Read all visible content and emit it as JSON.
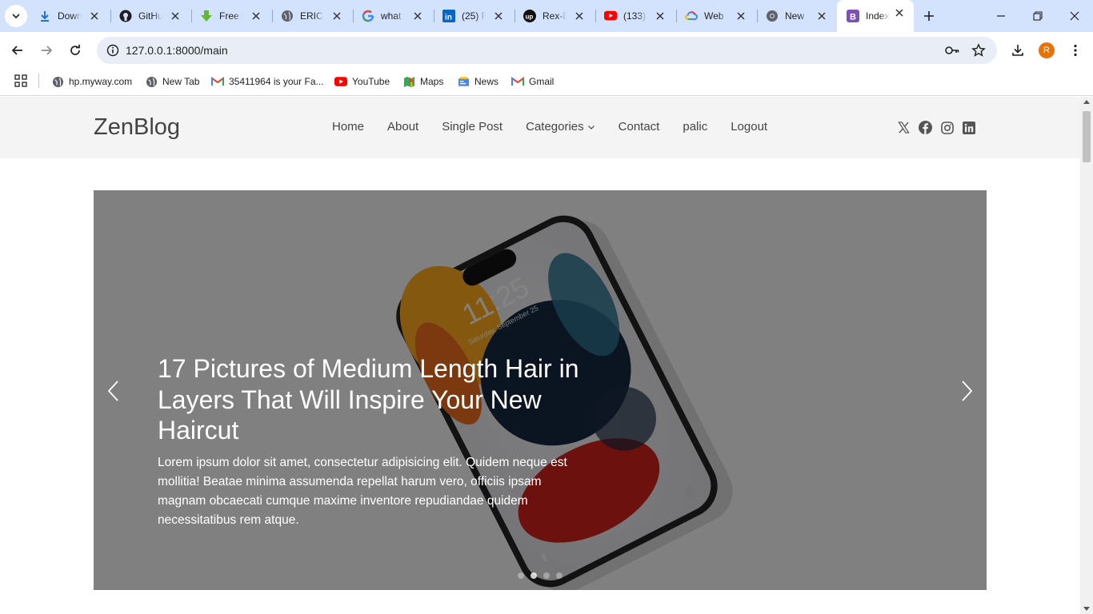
{
  "browser": {
    "tabs": [
      {
        "title": "Downloads",
        "icon": "download-icon"
      },
      {
        "title": "GitHub",
        "icon": "github-icon"
      },
      {
        "title": "Free Download",
        "icon": "download-arrow-icon"
      },
      {
        "title": "ERIC",
        "icon": "globe-icon"
      },
      {
        "title": "what",
        "icon": "google-icon"
      },
      {
        "title": "(25) F",
        "icon": "linkedin-icon"
      },
      {
        "title": "Rex-D",
        "icon": "upwork-icon"
      },
      {
        "title": "(133)",
        "icon": "youtube-icon"
      },
      {
        "title": "Web",
        "icon": "google-cloud-icon"
      },
      {
        "title": "New",
        "icon": "chrome-icon"
      },
      {
        "title": "Index",
        "icon": "bootstrap-icon",
        "active": true
      }
    ],
    "url": "127.0.0.1:8000/main",
    "profile_initial": "R",
    "bookmarks": [
      {
        "label": "hp.myway.com",
        "icon": "globe-icon"
      },
      {
        "label": "New Tab",
        "icon": "globe-icon"
      },
      {
        "label": "35411964 is your Fa...",
        "icon": "gmail-icon"
      },
      {
        "label": "YouTube",
        "icon": "youtube-icon"
      },
      {
        "label": "Maps",
        "icon": "maps-icon"
      },
      {
        "label": "News",
        "icon": "news-icon"
      },
      {
        "label": "Gmail",
        "icon": "gmail-icon"
      }
    ]
  },
  "site": {
    "logo": "ZenBlog",
    "nav": [
      "Home",
      "About",
      "Single Post",
      "Categories",
      "Contact",
      "palic",
      "Logout"
    ],
    "socials": [
      "x-icon",
      "facebook-icon",
      "instagram-icon",
      "linkedin-icon"
    ]
  },
  "hero": {
    "title": "17 Pictures of Medium Length Hair in Layers That Will Inspire Your New Haircut",
    "excerpt": "Lorem ipsum dolor sit amet, consectetur adipisicing elit. Quidem neque est mollitia! Beatae minima assumenda repellat harum vero, officiis ipsam magnam obcaecati cumque maxime inventore repudiandae quidem necessitatibus rem atque.",
    "phone_time": "11:25",
    "phone_date": "Saturday, September 25",
    "slide_count": 4,
    "active_slide": 2
  },
  "colors": {
    "tabstrip": "#d3e3fd",
    "omnibox": "#e9eef6",
    "header_bg": "#f4f4f4",
    "profile": "#e8710a"
  }
}
